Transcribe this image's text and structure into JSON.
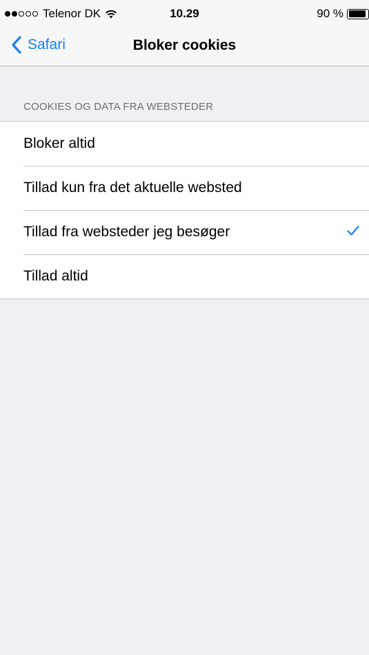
{
  "status_bar": {
    "carrier": "Telenor DK",
    "signal_bars_filled": 2,
    "signal_bars_total": 5,
    "time": "10.29",
    "battery_percent": "90 %",
    "wifi_icon": "wifi-icon",
    "battery_icon": "battery-icon"
  },
  "nav": {
    "back_label": "Safari",
    "back_icon": "chevron-left-icon",
    "title": "Bloker cookies"
  },
  "section": {
    "header": "COOKIES OG DATA FRA WEBSTEDER",
    "options": [
      {
        "label": "Bloker altid",
        "selected": false
      },
      {
        "label": "Tillad kun fra det aktuelle websted",
        "selected": false
      },
      {
        "label": "Tillad fra websteder jeg besøger",
        "selected": true
      },
      {
        "label": "Tillad altid",
        "selected": false
      }
    ]
  },
  "colors": {
    "accent": "#147efb",
    "background": "#efeff4",
    "separator": "#c8c7cc",
    "section_header": "#6d6d72"
  }
}
